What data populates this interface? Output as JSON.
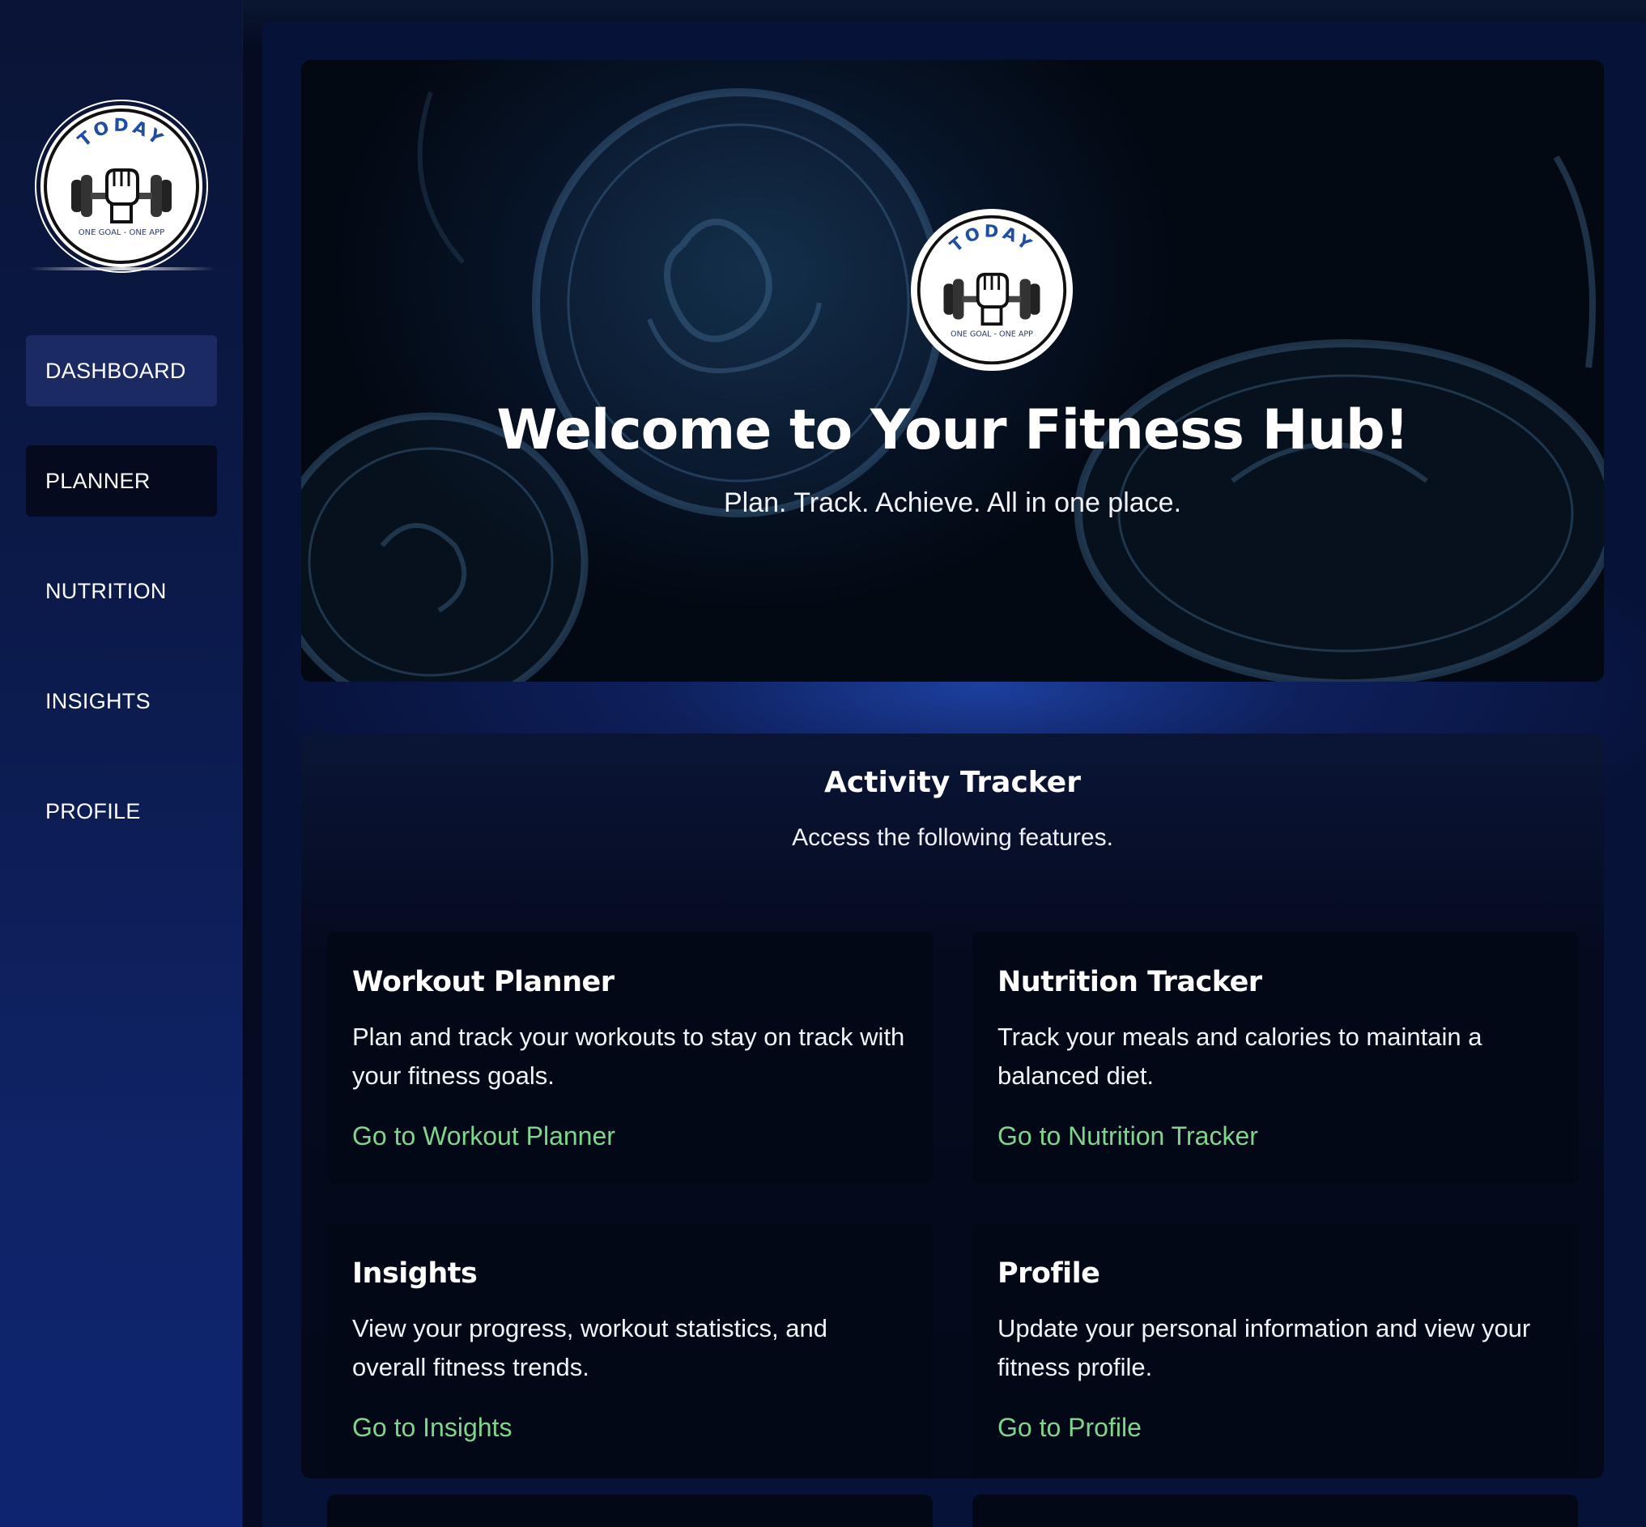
{
  "brand": {
    "logo_top_text": "TODAY",
    "logo_bottom_text": "ONE GOAL - ONE APP",
    "accent_blue": "#1f4ea3"
  },
  "sidebar": {
    "items": [
      {
        "label": "DASHBOARD",
        "state": "active"
      },
      {
        "label": "PLANNER",
        "state": "hover"
      },
      {
        "label": "NUTRITION",
        "state": "normal"
      },
      {
        "label": "INSIGHTS",
        "state": "normal"
      },
      {
        "label": "PROFILE",
        "state": "normal"
      }
    ]
  },
  "hero": {
    "title": "Welcome to Your Fitness Hub!",
    "subtitle": "Plan. Track. Achieve. All in one place."
  },
  "tracker": {
    "title": "Activity Tracker",
    "subtitle": "Access the following features.",
    "link_color": "#7fd58d",
    "cards": [
      {
        "title": "Workout Planner",
        "description": "Plan and track your workouts to stay on track with your fitness goals.",
        "link": "Go to Workout Planner"
      },
      {
        "title": "Nutrition Tracker",
        "description": "Track your meals and calories to maintain a balanced diet.",
        "link": "Go to Nutrition Tracker"
      },
      {
        "title": "Insights",
        "description": "View your progress, workout statistics, and overall fitness trends.",
        "link": "Go to Insights"
      },
      {
        "title": "Profile",
        "description": "Update your personal information and view your fitness profile.",
        "link": "Go to Profile"
      }
    ]
  }
}
